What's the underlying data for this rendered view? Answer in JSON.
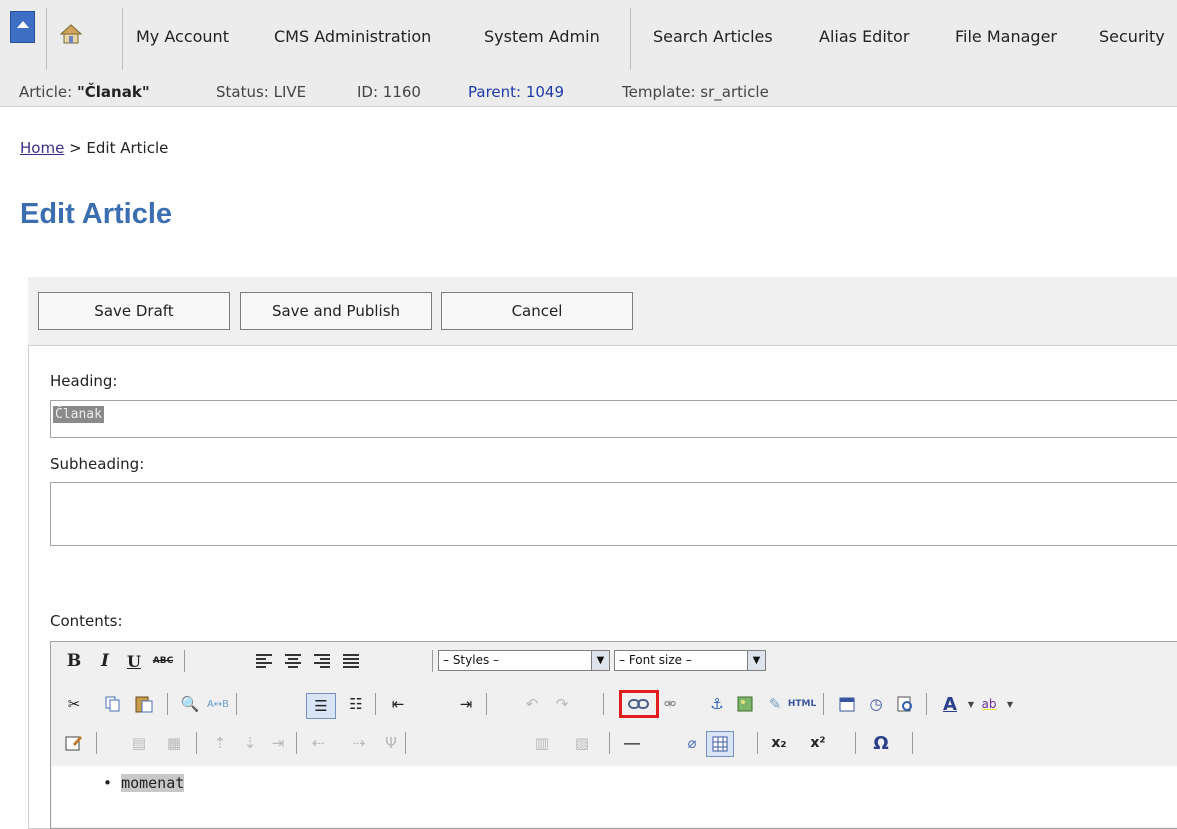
{
  "nav": {
    "items": [
      "My Account",
      "CMS Administration",
      "System Admin",
      "Search Articles",
      "Alias Editor",
      "File Manager",
      "Security"
    ]
  },
  "info": {
    "article_label": "Article: ",
    "article_name": "\"Članak\"",
    "status": "Status: LIVE",
    "id": "ID: 1160",
    "parent": "Parent: 1049",
    "template": "Template: sr_article"
  },
  "breadcrumb": {
    "home": "Home",
    "sep": " > ",
    "current": "Edit Article"
  },
  "page_title": "Edit Article",
  "buttons": {
    "save_draft": "Save Draft",
    "save_publish": "Save and Publish",
    "cancel": "Cancel"
  },
  "form": {
    "heading_label": "Heading:",
    "heading_value": "Članak",
    "subheading_label": "Subheading:",
    "subheading_value": "",
    "contents_label": "Contents:"
  },
  "editor": {
    "styles_select": "– Styles –",
    "fontsize_select": "– Font size –",
    "content_bullet": "momenat",
    "html_label": "HTML"
  }
}
